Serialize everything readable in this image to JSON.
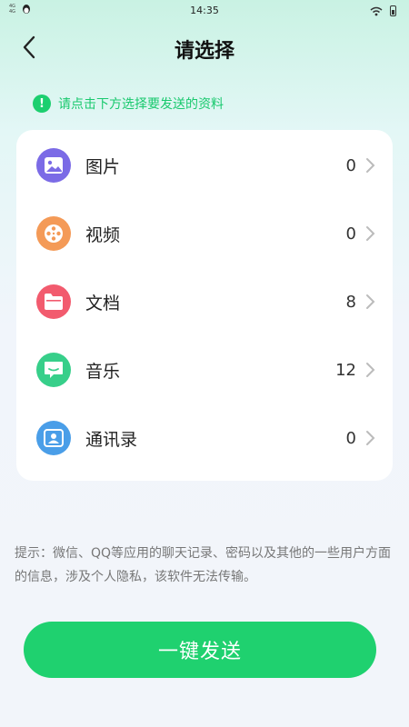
{
  "status_bar": {
    "time": "14:35",
    "sim1": "4G ",
    "sim2": "4G "
  },
  "header": {
    "title": "请选择",
    "back_icon": "chevron-left-icon"
  },
  "hint": {
    "text": "请点击下方选择要发送的资料",
    "icon": "info-icon",
    "color": "#1ccf6f"
  },
  "categories": [
    {
      "label": "图片",
      "count": "0",
      "icon": "image-icon",
      "color": "#7b6be6"
    },
    {
      "label": "视频",
      "count": "0",
      "icon": "film-reel-icon",
      "color": "#f49a57"
    },
    {
      "label": "文档",
      "count": "8",
      "icon": "folder-icon",
      "color": "#f25b6e"
    },
    {
      "label": "音乐",
      "count": "12",
      "icon": "chat-bubble-icon",
      "color": "#37cf8a"
    },
    {
      "label": "通讯录",
      "count": "0",
      "icon": "contact-card-icon",
      "color": "#4a9ee8"
    }
  ],
  "tip": {
    "text": "提示：微信、QQ等应用的聊天记录、密码以及其他的一些用户方面的信息，涉及个人隐私，该软件无法传输。"
  },
  "send_button": {
    "label": "一键发送",
    "color": "#1fd16f"
  }
}
